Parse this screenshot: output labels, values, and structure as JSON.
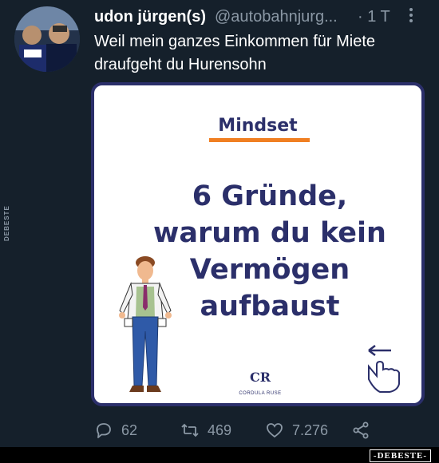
{
  "tweet": {
    "display_name": "udon jürgen(s)",
    "handle": "@autobahnjurg...",
    "time": "· 1 T",
    "more_icon": "more-vertical-icon",
    "text": "Weil mein ganzes Einkommen für Miete draufgeht du Hurensohn"
  },
  "media": {
    "tag": "Mindset",
    "headline_lines": [
      "6 Gründe,",
      "warum du kein",
      "Vermögen",
      "aufbaust"
    ],
    "logo_monogram": "CR",
    "logo_name": "CORDULA RUSE",
    "brand_color": "#2b2f6a",
    "accent_color": "#f07f22"
  },
  "actions": {
    "replies": "62",
    "retweets": "469",
    "likes": "7.276",
    "reply_icon": "reply-icon",
    "retweet_icon": "retweet-icon",
    "like_icon": "heart-icon",
    "share_icon": "share-icon"
  },
  "watermark": {
    "side": "DEBESTE",
    "corner": "-DEBESTE-"
  }
}
